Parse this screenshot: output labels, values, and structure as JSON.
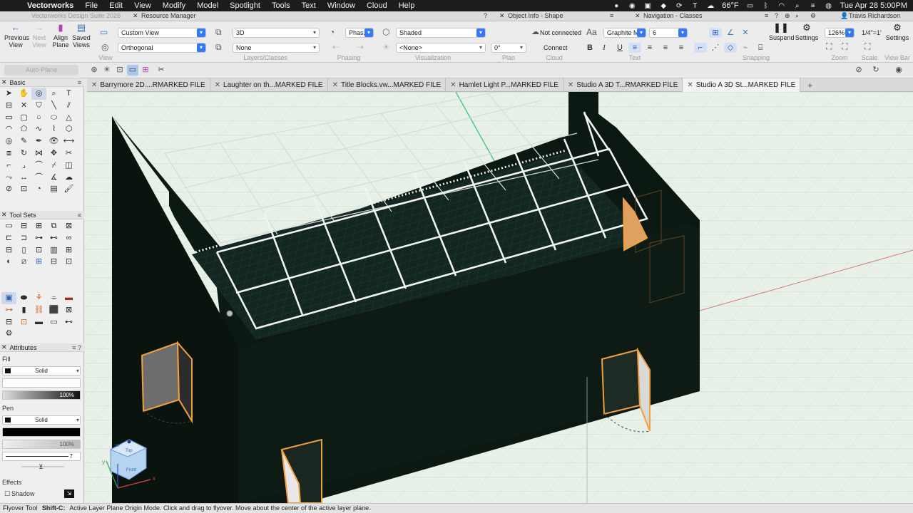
{
  "menubar": {
    "app_name": "Vectorworks",
    "items": [
      "File",
      "Edit",
      "View",
      "Modify",
      "Model",
      "Spotlight",
      "Tools",
      "Text",
      "Window",
      "Cloud",
      "Help"
    ],
    "status": {
      "temperature": "66°F",
      "datetime": "Tue Apr 28  5:00PM"
    }
  },
  "palette_titles": {
    "window_title_ghost": "Vectorworks Design Suite 2026",
    "resource_manager": "Resource Manager",
    "object_info": "Object Info - Shape",
    "navigation": "Navigation - Classes"
  },
  "user": {
    "name": "Travis Richardson"
  },
  "viewbar": {
    "previous_view": "Previous\nView",
    "next_view": "Next\nView",
    "align_plane": "Align\nPlane",
    "saved_views": "Saved\nViews",
    "group_view": "View",
    "view_select": "Custom View",
    "projection_select": "Orthogonal",
    "layer_select": "3D",
    "class_select": "None",
    "group_layers": "Layers/Classes",
    "phase_select": "Phas...",
    "group_phasing": "Phasing",
    "render_select": "Shaded",
    "lighting_select": "<None>",
    "group_visualization": "Visualization",
    "rotation_value": "0°",
    "group_plan_rotation": "Plan Rotation",
    "cloud_status": "Not connected",
    "connect_label": "Connect",
    "group_cloud": "Cloud Status",
    "font_select": "Graphite MM",
    "font_size": "6",
    "group_text": "Text",
    "group_snapping": "Snapping",
    "suspend_label": "Suspend",
    "settings_label": "Settings",
    "zoom_value": "126%",
    "group_zoom": "Zoom",
    "scale_value": "1/4\"=1'",
    "group_scale": "Scale",
    "settings2_label": "Settings",
    "group_viewbar": "View Bar"
  },
  "modebar": {
    "auto_plane": "Auto-Plane"
  },
  "tabs": [
    {
      "label": "Barrymore 2D....RMARKED FILE",
      "active": false
    },
    {
      "label": "Laughter on th...MARKED FILE",
      "active": false
    },
    {
      "label": "Title Blocks.vw...MARKED FILE",
      "active": false
    },
    {
      "label": "Hamlet Light P...MARKED FILE",
      "active": false
    },
    {
      "label": "Studio A 3D T...RMARKED FILE",
      "active": false
    },
    {
      "label": "Studio A 3D St...MARKED FILE",
      "active": true
    }
  ],
  "palettes": {
    "basic": "Basic",
    "tool_sets": "Tool Sets",
    "attributes": "Attributes",
    "fill_label": "Fill",
    "fill_style": "Solid",
    "fill_opacity": "100%",
    "pen_label": "Pen",
    "pen_style": "Solid",
    "pen_opacity": "100%",
    "line_weight": "7",
    "effects_label": "Effects",
    "shadow_label": "Shadow"
  },
  "viewcube": {
    "top": "Top",
    "front": "Front",
    "badge": "3D"
  },
  "axes": {
    "x": "x",
    "y": "y"
  },
  "status_bar": {
    "tool_name": "Flyover Tool",
    "shortcut": "Shift-C:",
    "message": "Active Layer Plane Origin Mode. Click and drag to flyover.  Move about the center of the active layer plane."
  },
  "colors": {
    "accent": "#3478f6",
    "canvas_bg": "#e8f1e7",
    "model_dark": "#0c1812",
    "door_orange": "#f0a040"
  }
}
